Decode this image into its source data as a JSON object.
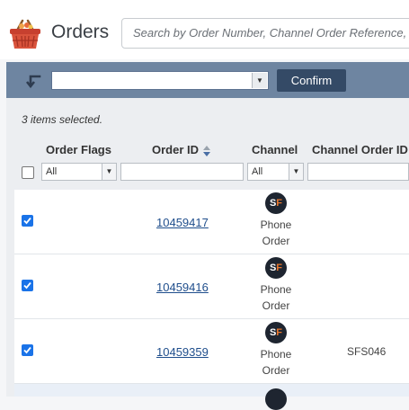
{
  "header": {
    "title": "Orders",
    "search_placeholder": "Search by Order Number, Channel Order Reference, Na"
  },
  "toolbar": {
    "action_value": "",
    "confirm_label": "Confirm"
  },
  "selection": {
    "text": "3 items selected."
  },
  "table": {
    "columns": [
      "Order Flags",
      "Order ID",
      "Channel",
      "Channel Order ID"
    ],
    "filters": {
      "order_flags": "All",
      "order_id": "",
      "channel": "All",
      "channel_order_id": ""
    },
    "rows": [
      {
        "checked": true,
        "order_id": "10459417",
        "channel_line1": "Phone",
        "channel_line2": "Order",
        "channel_order_id": ""
      },
      {
        "checked": true,
        "order_id": "10459416",
        "channel_line1": "Phone",
        "channel_line2": "Order",
        "channel_order_id": ""
      },
      {
        "checked": true,
        "order_id": "10459359",
        "channel_line1": "Phone",
        "channel_line2": "Order",
        "channel_order_id": "SFS046"
      }
    ],
    "channel_badge": {
      "s": "S",
      "f": "F"
    }
  },
  "colors": {
    "toolbar_bg": "#6e85a1",
    "confirm_bg": "#344a66",
    "link": "#1f4e8c",
    "checkbox": "#1a73e8",
    "badge_accent": "#e8762d"
  },
  "icons": {
    "app": "basket-icon",
    "action": "return-arrow-icon",
    "sort": "sort-icon",
    "dropdown": "chevron-down-icon",
    "check": "check-icon"
  }
}
